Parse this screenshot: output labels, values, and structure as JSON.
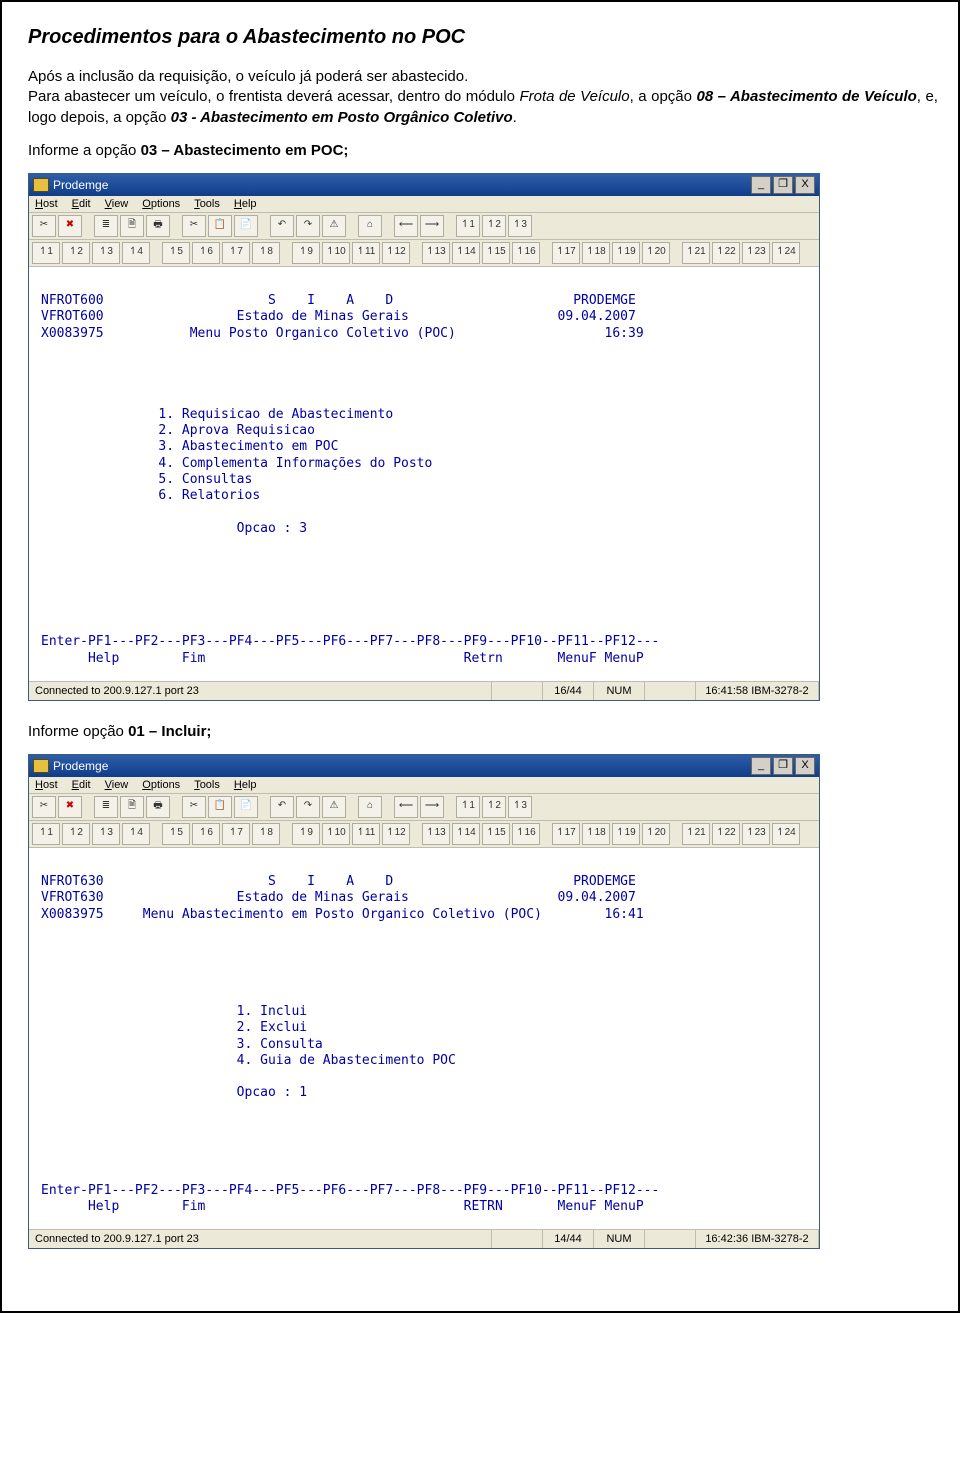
{
  "doc": {
    "title": "Procedimentos para o Abastecimento no POC",
    "p1_line1": "Após a inclusão da requisição, o veículo já poderá ser abastecido.",
    "p2_a": "Para abastecer um veículo, o frentista deverá acessar, dentro do módulo ",
    "p2_b_ital": "Frota de Veículo",
    "p2_c": ", a opção ",
    "p2_d_strong": "08 – Abastecimento de Veículo",
    "p2_e": ", e, logo depois, a opção ",
    "p2_f_strong": "03 - Abastecimento em Posto Orgânico Coletivo",
    "p2_g": ".",
    "instr1_a": "Informe a opção ",
    "instr1_b": "03 – Abastecimento em POC;",
    "instr2_a": "Informe opção ",
    "instr2_b": "01 – Incluir;"
  },
  "window": {
    "title": "Prodemge",
    "btn_min": "_",
    "btn_max": "❐",
    "btn_close": "X",
    "menu": {
      "host": "Host",
      "edit": "Edit",
      "view": "View",
      "options": "Options",
      "tools": "Tools",
      "help": "Help"
    }
  },
  "toolbar_icons": [
    " ",
    " ",
    " ",
    " ",
    " ",
    " ",
    " ",
    " ",
    " ",
    " ",
    " ",
    " ",
    " ",
    " ",
    " ",
    " ",
    " ",
    " ",
    " "
  ],
  "fkeys_row1": [
    "↿1",
    "↿2",
    "↿3",
    "↿4",
    "↿5",
    "↿6",
    "↿7",
    "↿8",
    "↿9",
    "↿10",
    "↿11",
    "↿12",
    "↿13",
    "↿14",
    "↿15",
    "↿16",
    "↿17",
    "↿18",
    "↿19",
    "↿20",
    "↿21",
    "↿22",
    "↿23",
    "↿24"
  ],
  "term1": {
    "body": "\nNFROT600                     S    I    A    D                       PRODEMGE\nVFROT600                 Estado de Minas Gerais                   09.04.2007\nX0083975           Menu Posto Organico Coletivo (POC)                   16:39\n\n\n\n\n               1. Requisicao de Abastecimento\n               2. Aprova Requisicao\n               3. Abastecimento em POC\n               4. Complementa Informações do Posto\n               5. Consultas\n               6. Relatorios\n\n                         Opcao : 3\n\n\n\n\n\n\nEnter-PF1---PF2---PF3---PF4---PF5---PF6---PF7---PF8---PF9---PF10--PF11--PF12---\n      Help        Fim                                 Retrn       MenuF MenuP",
    "status": {
      "conn": "Connected to 200.9.127.1 port 23",
      "rc": "16/44",
      "num": "NUM",
      "ts": "16:41:58",
      "mode": "IBM-3278-2"
    }
  },
  "term2": {
    "body": "\nNFROT630                     S    I    A    D                       PRODEMGE\nVFROT630                 Estado de Minas Gerais                   09.04.2007\nX0083975     Menu Abastecimento em Posto Organico Coletivo (POC)        16:41\n\n\n\n\n\n                         1. Inclui\n                         2. Exclui\n                         3. Consulta\n                         4. Guia de Abastecimento POC\n\n                         Opcao : 1\n\n\n\n\n\nEnter-PF1---PF2---PF3---PF4---PF5---PF6---PF7---PF8---PF9---PF10--PF11--PF12---\n      Help        Fim                                 RETRN       MenuF MenuP",
    "status": {
      "conn": "Connected to 200.9.127.1 port 23",
      "rc": "14/44",
      "num": "NUM",
      "ts": "16:42:36",
      "mode": "IBM-3278-2"
    }
  }
}
